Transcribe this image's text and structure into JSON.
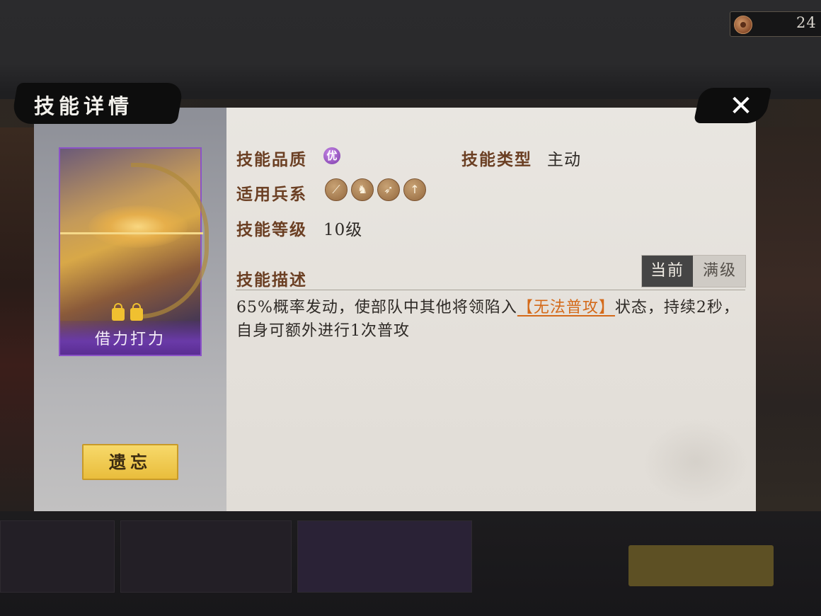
{
  "currency": {
    "value": "24",
    "icon": "coin-icon"
  },
  "dialog": {
    "title": "技能详情",
    "close_icon": "✕",
    "card": {
      "name": "借力打力",
      "border_color": "#8b52c8"
    },
    "forget_button": "遗忘",
    "quality": {
      "label": "技能品质",
      "badge": "优",
      "badge_color": "#7a3aa8"
    },
    "type": {
      "label": "技能类型",
      "value": "主动"
    },
    "troops": {
      "label": "适用兵系",
      "icons": [
        {
          "name": "sword-icon",
          "glyph": "⟋"
        },
        {
          "name": "horse-icon",
          "glyph": "♞"
        },
        {
          "name": "bow-icon",
          "glyph": "➶"
        },
        {
          "name": "spear-icon",
          "glyph": "↑"
        }
      ]
    },
    "level": {
      "label": "技能等级",
      "value": "10级"
    },
    "description": {
      "label": "技能描述",
      "tabs": {
        "current": "当前",
        "max": "满级"
      },
      "text_before": "65%概率发动，使部队中其他将领陷入",
      "highlight": "【无法普攻】",
      "text_after": "状态，持续2秒，自身可额外进行1次普攻",
      "highlight_color": "#d46a1a"
    }
  }
}
